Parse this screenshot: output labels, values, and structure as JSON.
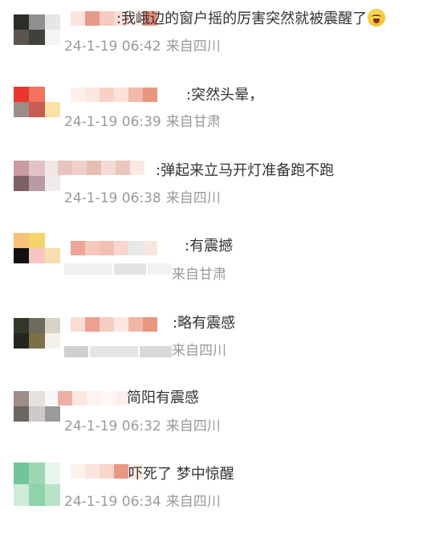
{
  "comments": [
    {
      "text": ":我峨边的窗户摇的厉害突然就被震醒了",
      "emoji": "惊讶表情",
      "time": "24-1-19 06:42",
      "source": "来自四川",
      "avatar_colors": [
        "#2b2e27",
        "#8f8f8f",
        "#e6e6e6",
        "#5b554d",
        "#3f423b",
        "#f4f4f4"
      ],
      "username_colors": [
        "#fbe3dd",
        "#e49b8a",
        "#f7c9c0",
        "#f9ddd6",
        "#fdeee9",
        "#e58e7c"
      ]
    },
    {
      "text": ":突然头晕，",
      "time": "24-1-19 06:39",
      "source": "来自甘肃",
      "avatar_colors": [
        "#e8362f",
        "#f1735c",
        "#ffffff",
        "#9b8e87",
        "#c75b55",
        "#fbe1a7"
      ],
      "username_colors": [
        "#fdf0ec",
        "#fde7e1",
        "#f8d0c6",
        "#fbe0d9",
        "#f0b9aa",
        "#e8967f"
      ]
    },
    {
      "text": ":弹起来立马开灯准备跑不跑",
      "time": "24-1-19 06:38",
      "source": "来自四川",
      "avatar_colors": [
        "#c99aa2",
        "#e2c2c6",
        "#f1e6e8",
        "#7e6066",
        "#b89ba3",
        "#efeaed"
      ],
      "username_colors": [
        "#e8c4bd",
        "#efd0ca",
        "#e5bdb3",
        "#f3dcd6",
        "#ecc7bd",
        "#fae9e4"
      ]
    },
    {
      "text": ":有震撼",
      "time": "",
      "source": "来自甘肃",
      "avatar_colors": [
        "#f5c27a",
        "#f4d46b",
        "#ffffff",
        "#111111",
        "#f7c6c2",
        "#f6dfae"
      ],
      "username_colors": [
        "#eca596",
        "#f4c8bc",
        "#f2bfb2",
        "#f7d6cd",
        "#e8e8e8",
        "#f9e6e0"
      ]
    },
    {
      "text": ":略有震感",
      "time": "",
      "source": "来自四川",
      "avatar_colors": [
        "#34352a",
        "#6e6a5c",
        "#d8d3c6",
        "#25261f",
        "#7c6f4a",
        "#f4f1ea"
      ],
      "username_colors": [
        "#f9ddd5",
        "#eca08f",
        "#f6cdc3",
        "#fbe6e0",
        "#f0b7a9",
        "#e9957f"
      ]
    },
    {
      "text": "简阳有震感",
      "time": "24-1-19 06:32",
      "source": "来自四川",
      "avatar_colors": [
        "#9e8c88",
        "#e6e1dc",
        "#f8f8f8",
        "#6c6662",
        "#cfc9c9",
        "#9a9a9a"
      ],
      "username_colors": [
        "#ecb1a6",
        "#fae7e2",
        "#fdf3f0",
        "#fef7f5",
        "#fbeeeb",
        "#ffffff"
      ]
    },
    {
      "text": "吓死了 梦中惊醒",
      "time": "24-1-19 06:34",
      "source": "来自四川",
      "avatar_colors": [
        "#72c59b",
        "#9ed5b3",
        "#e6f6ec",
        "#ccecd8",
        "#8ed3aa",
        "#b9e3c7"
      ],
      "username_colors": [
        "#fdf1ee",
        "#fae4de",
        "#f8d6cc",
        "#e99884",
        "#fbe7e1",
        "#ffffff"
      ]
    }
  ]
}
